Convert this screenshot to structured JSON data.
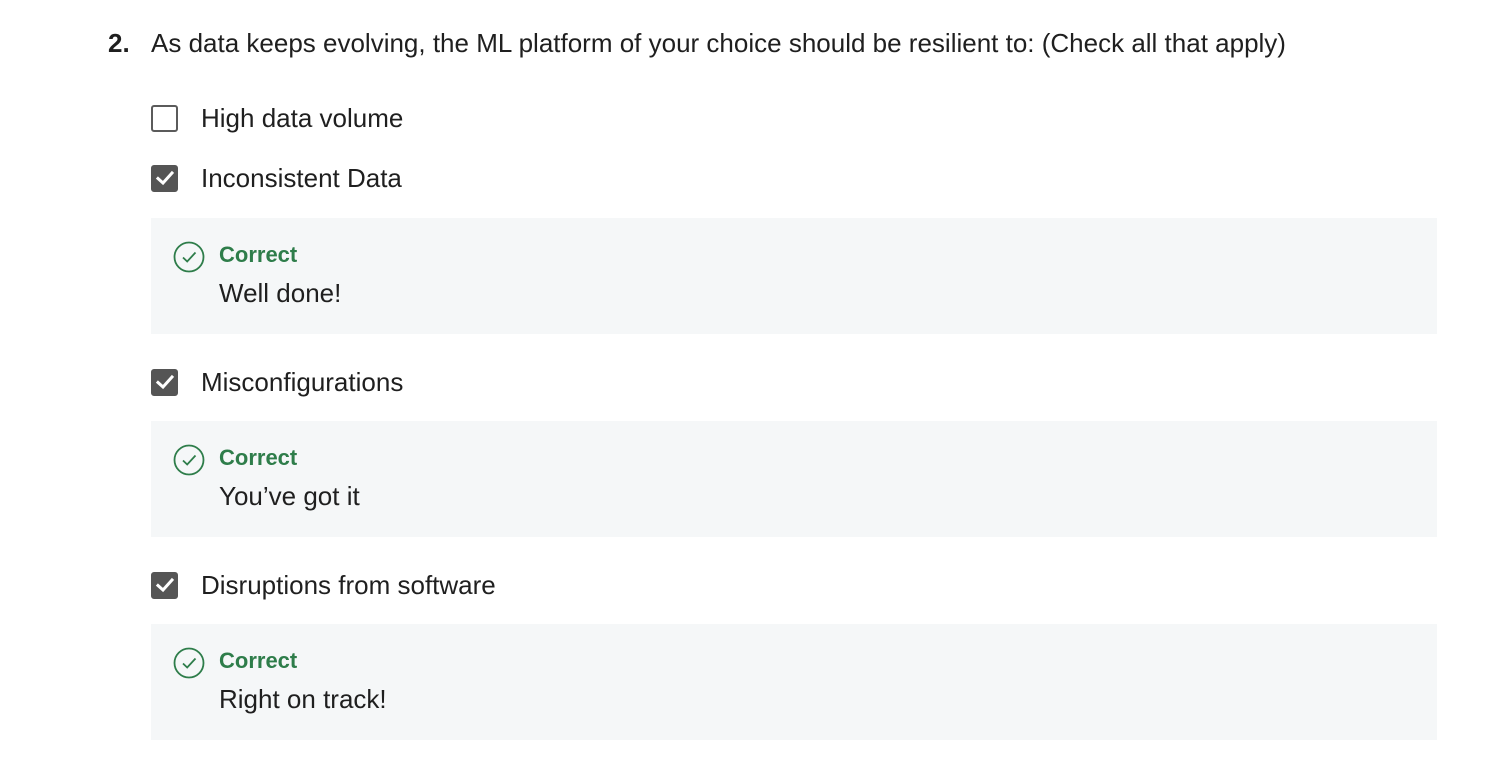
{
  "question": {
    "number": "2.",
    "text": "As data keeps evolving, the ML platform of your choice should be resilient to: (Check all that apply)"
  },
  "options": [
    {
      "label": "High data volume",
      "checked": false
    },
    {
      "label": "Inconsistent Data",
      "checked": true,
      "feedback": {
        "status": "Correct",
        "message": "Well done!"
      }
    },
    {
      "label": "Misconfigurations",
      "checked": true,
      "feedback": {
        "status": "Correct",
        "message": "You’ve got it"
      }
    },
    {
      "label": "Disruptions from software",
      "checked": true,
      "feedback": {
        "status": "Correct",
        "message": "Right on track!"
      }
    }
  ],
  "icons": {
    "checkbox_checked": "checkmark-icon",
    "feedback": "check-circle-icon"
  },
  "colors": {
    "correct": "#2e7d4a",
    "checkbox": "#555555",
    "feedback_bg": "#f5f7f8"
  }
}
